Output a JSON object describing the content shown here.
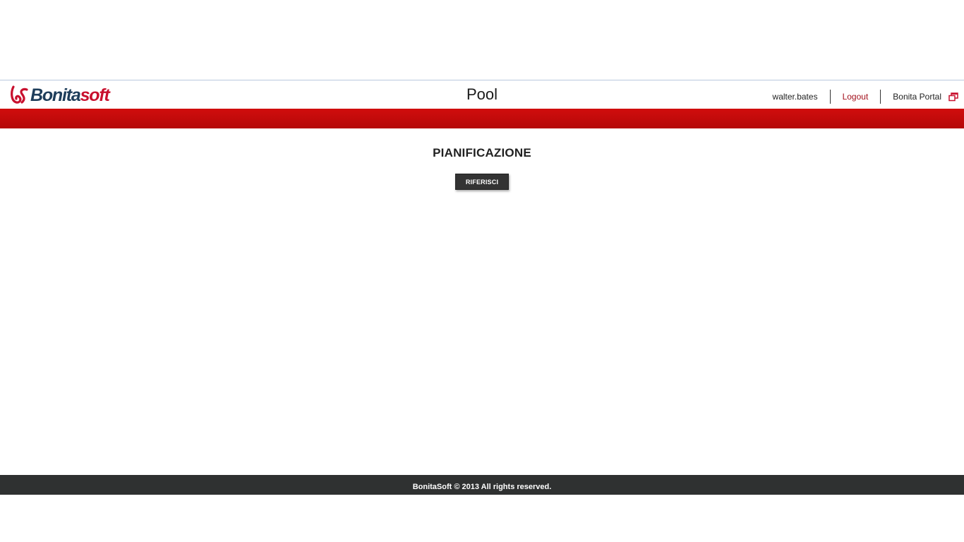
{
  "header": {
    "logo": {
      "text_main": "Bonita",
      "text_accent": "soft",
      "icon": "bonitasoft-logo-icon",
      "brand_blue": "#1e3d5a",
      "brand_red": "#c8102e"
    },
    "title": "Pool",
    "nav": {
      "user": "walter.bates",
      "logout": "Logout",
      "portal": "Bonita Portal",
      "portal_icon": "external-window-icon"
    }
  },
  "colors": {
    "red_bar": "#c40b0b",
    "footer_bg": "#2f3131",
    "button_bg": "#333333",
    "logout_link": "#a3101c"
  },
  "form": {
    "title": "PIANIFICAZIONE",
    "submit_label": "RIFERISCI"
  },
  "footer": {
    "text": "BonitaSoft © 2013 All rights reserved."
  }
}
